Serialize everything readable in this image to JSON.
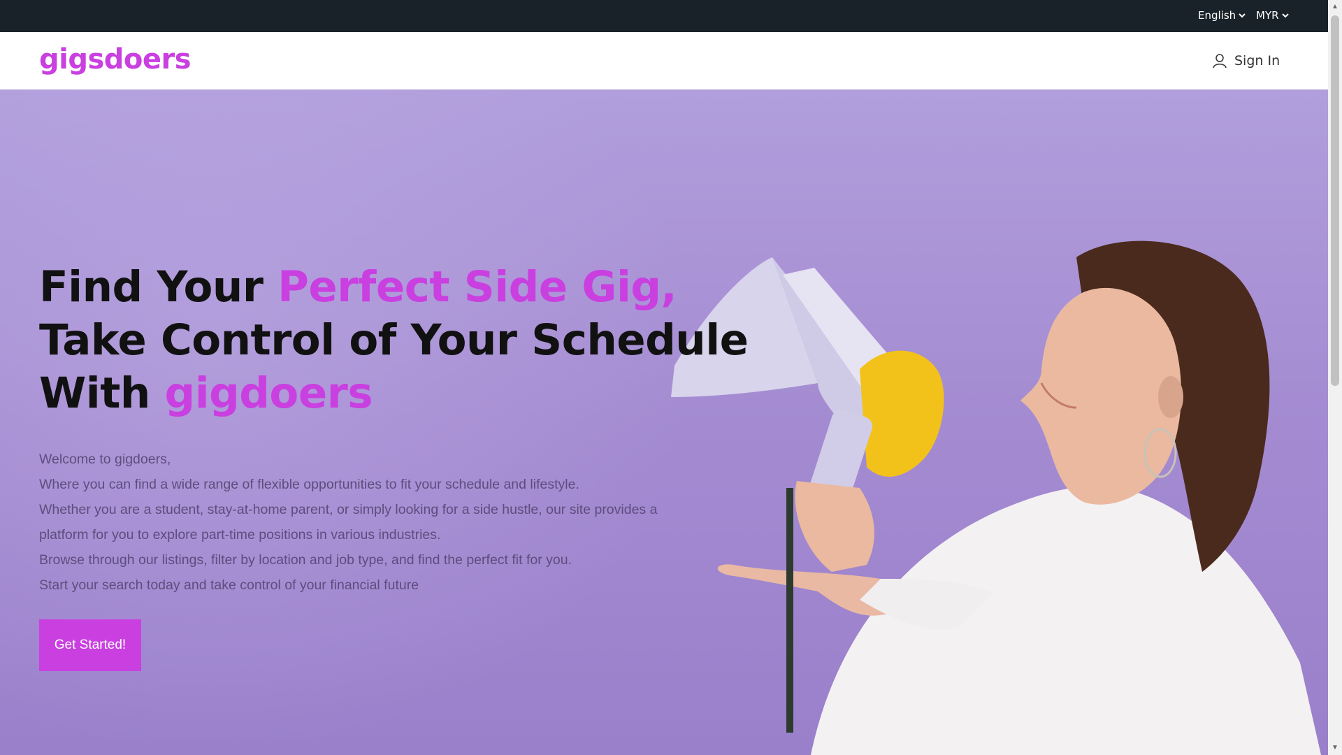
{
  "topbar": {
    "language": "English",
    "currency": "MYR"
  },
  "navbar": {
    "logo": "gigsdoers",
    "signin_label": "Sign In"
  },
  "hero": {
    "line1_prefix": "Find Your ",
    "line1_accent": "Perfect Side Gig,",
    "line2": "Take Control of Your Schedule",
    "line3_prefix": "With ",
    "line3_accent": "gigdoers",
    "paragraph": [
      "Welcome to gigdoers,",
      "Where you can find a wide range of flexible opportunities to fit your schedule and lifestyle.",
      "Whether you are a student, stay-at-home parent, or simply looking for a side hustle, our site provides a platform for you to explore part-time positions in various industries.",
      "Browse through our listings, filter by location and job type, and find the perfect fit for you.",
      "Start your search today and take control of your financial future"
    ],
    "cta_label": "Get Started!"
  },
  "colors": {
    "brand": "#c93fe0",
    "topbar": "#1a2229",
    "hero_bg": "#a48bd1"
  },
  "icons": {
    "language_dropdown": "chevron-down-icon",
    "currency_dropdown": "chevron-down-icon",
    "signin": "user-icon"
  }
}
